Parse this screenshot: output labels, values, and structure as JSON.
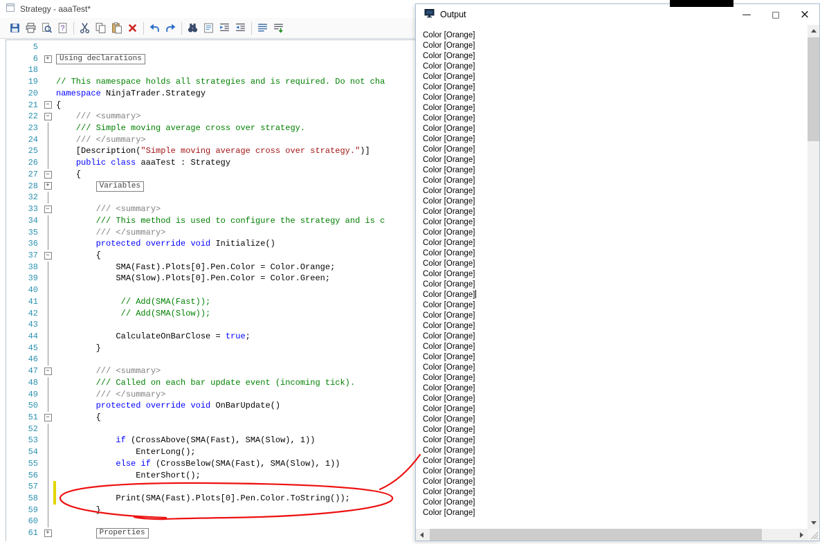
{
  "editor": {
    "title": "Strategy - aaaTest*",
    "window_icon": "document-icon",
    "toolbar_groups": [
      [
        "save",
        "print",
        "print-preview",
        "help"
      ],
      [
        "cut",
        "copy",
        "paste",
        "delete"
      ],
      [
        "undo",
        "redo"
      ],
      [
        "find",
        "replace",
        "indent",
        "outdent"
      ],
      [
        "justify",
        "compile"
      ]
    ],
    "colors": {
      "keyword": "#0000ff",
      "comment": "#008000",
      "doc_comment": "#808080",
      "string": "#a31515",
      "line_number": "#2b91af",
      "modified_marker": "#e3d400"
    },
    "lines": [
      {
        "n": "5",
        "f": "",
        "segs": []
      },
      {
        "n": "6",
        "f": "plus",
        "pre": "",
        "box": "Using declarations",
        "segs": []
      },
      {
        "n": "18",
        "f": "",
        "segs": []
      },
      {
        "n": "19",
        "f": "",
        "segs": [
          [
            "c",
            "// This namespace holds all strategies and is required. Do not cha"
          ]
        ]
      },
      {
        "n": "20",
        "f": "",
        "segs": [
          [
            "k",
            "namespace"
          ],
          [
            "p",
            " NinjaTrader.Strategy"
          ]
        ]
      },
      {
        "n": "21",
        "f": "minus",
        "segs": [
          [
            "p",
            "{"
          ]
        ]
      },
      {
        "n": "22",
        "f": "minus",
        "segs": [
          [
            "g",
            "    /// <summary>"
          ]
        ]
      },
      {
        "n": "23",
        "f": "line",
        "segs": [
          [
            "c",
            "    /// Simple moving average cross over strategy."
          ]
        ]
      },
      {
        "n": "24",
        "f": "line",
        "segs": [
          [
            "g",
            "    /// </summary>"
          ]
        ]
      },
      {
        "n": "25",
        "f": "line",
        "segs": [
          [
            "p",
            "    [Description("
          ],
          [
            "s",
            "\"Simple moving average cross over strategy.\""
          ],
          [
            "p",
            ")]"
          ]
        ]
      },
      {
        "n": "26",
        "f": "line",
        "segs": [
          [
            "p",
            "    "
          ],
          [
            "k",
            "public"
          ],
          [
            "p",
            " "
          ],
          [
            "k",
            "class"
          ],
          [
            "p",
            " aaaTest : Strategy"
          ]
        ]
      },
      {
        "n": "27",
        "f": "minus",
        "segs": [
          [
            "p",
            "    {"
          ]
        ]
      },
      {
        "n": "28",
        "f": "plus",
        "pre": "        ",
        "box": "Variables",
        "segs": []
      },
      {
        "n": "32",
        "f": "line",
        "segs": []
      },
      {
        "n": "33",
        "f": "minus",
        "segs": [
          [
            "g",
            "        /// <summary>"
          ]
        ]
      },
      {
        "n": "34",
        "f": "line",
        "segs": [
          [
            "c",
            "        /// This method is used to configure the strategy and is c"
          ]
        ]
      },
      {
        "n": "35",
        "f": "line",
        "segs": [
          [
            "g",
            "        /// </summary>"
          ]
        ]
      },
      {
        "n": "36",
        "f": "line",
        "segs": [
          [
            "p",
            "        "
          ],
          [
            "k",
            "protected"
          ],
          [
            "p",
            " "
          ],
          [
            "k",
            "override"
          ],
          [
            "p",
            " "
          ],
          [
            "k",
            "void"
          ],
          [
            "p",
            " Initialize()"
          ]
        ]
      },
      {
        "n": "37",
        "f": "minus",
        "segs": [
          [
            "p",
            "        {"
          ]
        ]
      },
      {
        "n": "38",
        "f": "line",
        "segs": [
          [
            "p",
            "            SMA(Fast).Plots[0].Pen.Color = Color.Orange;"
          ]
        ]
      },
      {
        "n": "39",
        "f": "line",
        "segs": [
          [
            "p",
            "            SMA(Slow).Plots[0].Pen.Color = Color.Green;"
          ]
        ]
      },
      {
        "n": "40",
        "f": "line",
        "segs": []
      },
      {
        "n": "41",
        "f": "line",
        "segs": [
          [
            "c",
            "             // Add(SMA(Fast));"
          ]
        ]
      },
      {
        "n": "42",
        "f": "line",
        "segs": [
          [
            "c",
            "             // Add(SMA(Slow));"
          ]
        ]
      },
      {
        "n": "43",
        "f": "line",
        "segs": []
      },
      {
        "n": "44",
        "f": "line",
        "segs": [
          [
            "p",
            "            CalculateOnBarClose = "
          ],
          [
            "k",
            "true"
          ],
          [
            "p",
            ";"
          ]
        ]
      },
      {
        "n": "45",
        "f": "line",
        "segs": [
          [
            "p",
            "        }"
          ]
        ]
      },
      {
        "n": "46",
        "f": "line",
        "segs": []
      },
      {
        "n": "47",
        "f": "minus",
        "segs": [
          [
            "g",
            "        /// <summary>"
          ]
        ]
      },
      {
        "n": "48",
        "f": "line",
        "segs": [
          [
            "c",
            "        /// Called on each bar update event (incoming tick)."
          ]
        ]
      },
      {
        "n": "49",
        "f": "line",
        "segs": [
          [
            "g",
            "        /// </summary>"
          ]
        ]
      },
      {
        "n": "50",
        "f": "line",
        "segs": [
          [
            "p",
            "        "
          ],
          [
            "k",
            "protected"
          ],
          [
            "p",
            " "
          ],
          [
            "k",
            "override"
          ],
          [
            "p",
            " "
          ],
          [
            "k",
            "void"
          ],
          [
            "p",
            " OnBarUpdate()"
          ]
        ]
      },
      {
        "n": "51",
        "f": "minus",
        "segs": [
          [
            "p",
            "        {"
          ]
        ]
      },
      {
        "n": "52",
        "f": "line",
        "segs": []
      },
      {
        "n": "53",
        "f": "line",
        "segs": [
          [
            "p",
            "            "
          ],
          [
            "k",
            "if"
          ],
          [
            "p",
            " (CrossAbove(SMA(Fast), SMA(Slow), 1))"
          ]
        ]
      },
      {
        "n": "54",
        "f": "line",
        "segs": [
          [
            "p",
            "                EnterLong();"
          ]
        ]
      },
      {
        "n": "55",
        "f": "line",
        "segs": [
          [
            "p",
            "            "
          ],
          [
            "k",
            "else"
          ],
          [
            "p",
            " "
          ],
          [
            "k",
            "if"
          ],
          [
            "p",
            " (CrossBelow(SMA(Fast), SMA(Slow), 1))"
          ]
        ]
      },
      {
        "n": "56",
        "f": "line",
        "segs": [
          [
            "p",
            "                EnterShort();"
          ]
        ]
      },
      {
        "n": "57",
        "f": "line",
        "m": true,
        "segs": []
      },
      {
        "n": "58",
        "f": "line",
        "m": true,
        "segs": [
          [
            "p",
            "            Print(SMA(Fast).Plots[0].Pen.Color.ToString());"
          ]
        ]
      },
      {
        "n": "59",
        "f": "line",
        "segs": [
          [
            "p",
            "        }"
          ]
        ]
      },
      {
        "n": "60",
        "f": "line",
        "segs": []
      },
      {
        "n": "61",
        "f": "plus",
        "pre": "        ",
        "box": "Properties",
        "segs": []
      }
    ]
  },
  "output": {
    "title": "Output",
    "window_icon": "console-icon",
    "buttons": {
      "minimize": "—",
      "maximize": "□",
      "close": "×"
    },
    "line_text": "Color [Orange]",
    "line_count": 47,
    "cursor_line": 26
  },
  "annotation": {
    "color": "#ed1111"
  }
}
